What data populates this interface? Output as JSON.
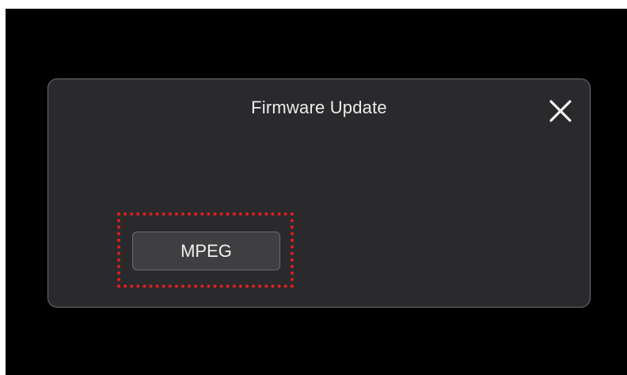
{
  "dialog": {
    "title": "Firmware Update",
    "close_icon": "close-icon",
    "options": [
      {
        "label": "MPEG"
      }
    ]
  },
  "colors": {
    "screen_background": "#000000",
    "dialog_background": "#2a2a2d",
    "dialog_border": "#6e6e72",
    "button_background": "#3f3f42",
    "highlight": "#e11d1d",
    "text": "#ececec"
  }
}
